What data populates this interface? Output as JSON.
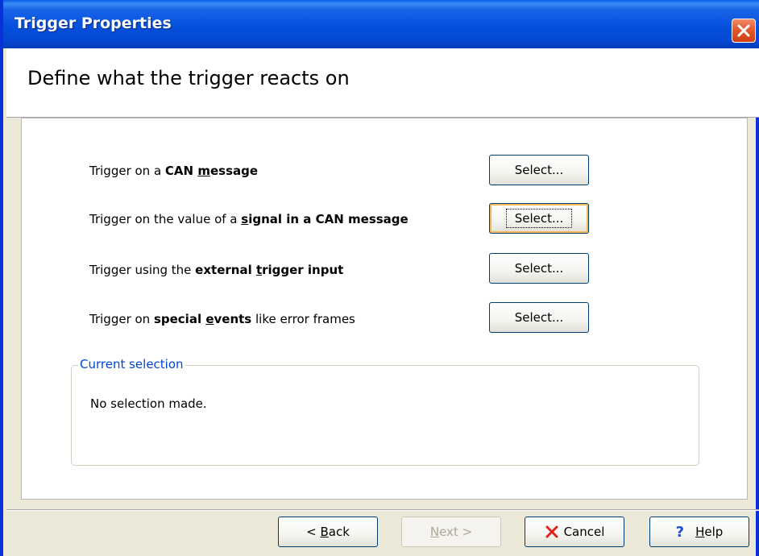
{
  "window": {
    "title": "Trigger Properties"
  },
  "header": {
    "heading": "Define what the trigger reacts on"
  },
  "options": [
    {
      "pre": "Trigger on a ",
      "bold_pre": "CAN ",
      "bold_u": "m",
      "bold_post": "essage",
      "post": "",
      "button": "Select..."
    },
    {
      "pre": "Trigger on the value of a ",
      "bold_pre": "",
      "bold_u": "s",
      "bold_post": "ignal in a CAN message",
      "post": "",
      "button": "Select..."
    },
    {
      "pre": "Trigger using the ",
      "bold_pre": "external ",
      "bold_u": "t",
      "bold_post": "rigger input",
      "post": "",
      "button": "Select..."
    },
    {
      "pre": "Trigger on ",
      "bold_pre": "special ",
      "bold_u": "e",
      "bold_post": "vents",
      "post": " like error frames",
      "button": "Select..."
    }
  ],
  "current_selection": {
    "legend": "Current selection",
    "status": "No selection made."
  },
  "footer": {
    "back_prefix": "< ",
    "back_u": "B",
    "back_rest": "ack",
    "next_u": "N",
    "next_rest": "ext >",
    "cancel": "Cancel",
    "help_u": "H",
    "help_rest": "elp",
    "help_glyph": "?"
  },
  "colors": {
    "titlebar": "#0550dc",
    "frame": "#0831d9",
    "legend": "#0046d5",
    "cancel_x": "#e0231c",
    "help_q": "#1c4fd8"
  },
  "icons": {
    "close": "close-icon",
    "cancel": "x-mark-icon",
    "help": "question-mark-icon"
  }
}
